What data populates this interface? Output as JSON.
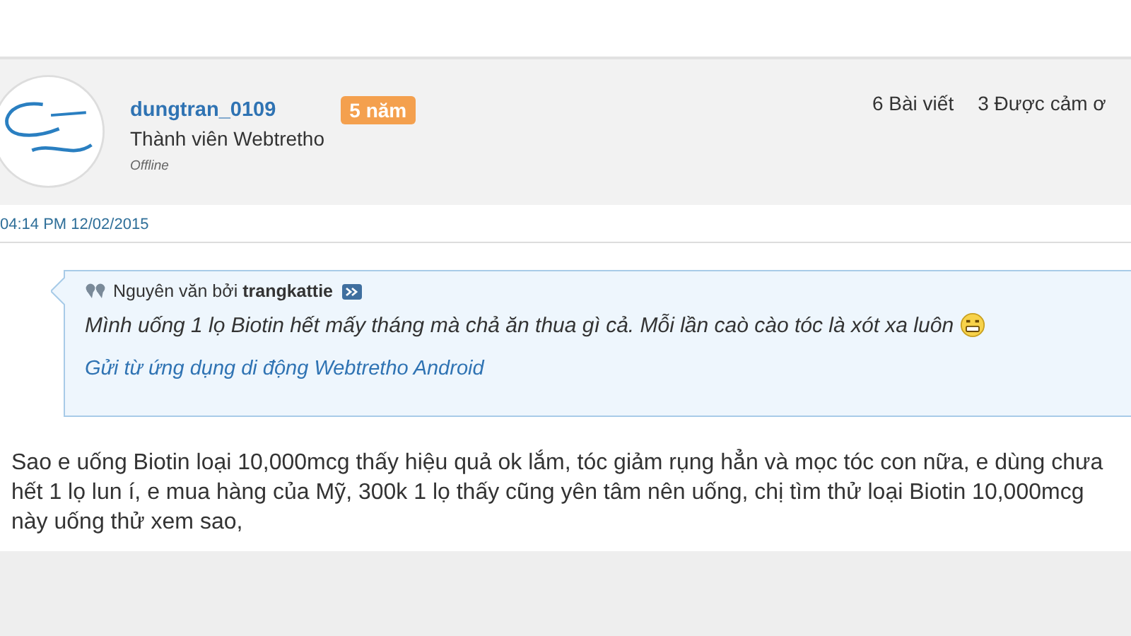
{
  "post": {
    "author": {
      "username": "dungtran_0109",
      "badge": "5 năm",
      "rank": "Thành viên Webtretho",
      "status": "Offline"
    },
    "stats": [
      "6 Bài viết",
      "3 Được cảm ơ"
    ],
    "timestamp": "04:14 PM 12/02/2015",
    "quote": {
      "label": "Nguyên văn bởi",
      "author": "trangkattie",
      "text": "Mình uống 1 lọ Biotin hết mấy tháng mà chả ăn thua gì cả. Mỗi lần caò cào tóc là xót xa luôn",
      "signature": "Gửi từ ứng dụng di động Webtretho Android"
    },
    "body_lines": [
      "Sao e uống Biotin loại 10,000mcg thấy hiệu quả ok lắm, tóc giảm rụng hẳn và mọc tóc con nữa, e dùng chưa",
      "hết 1 lọ lun í, e mua hàng của Mỹ, 300k 1 lọ thấy cũng yên tâm nên uống, chị tìm thử loại Biotin 10,000mcg",
      "này uống thử xem sao,"
    ]
  }
}
